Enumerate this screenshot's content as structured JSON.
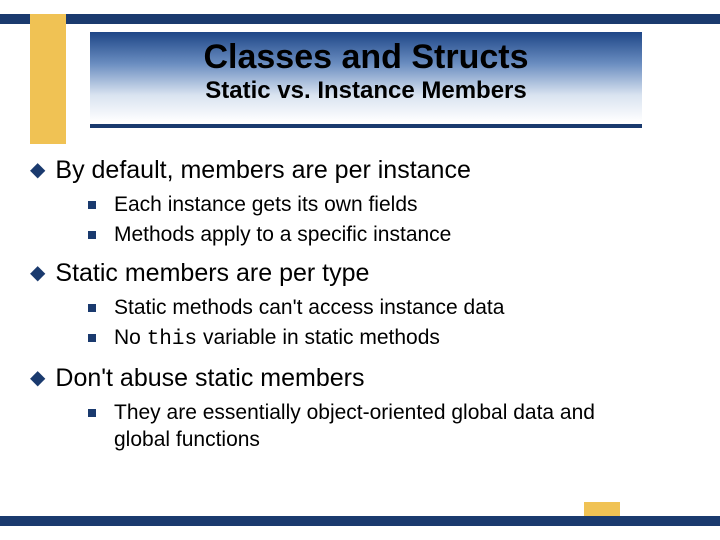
{
  "title": {
    "main": "Classes and Structs",
    "sub": "Static vs. Instance Members"
  },
  "bullets": [
    {
      "text": "By default, members are per instance",
      "sub": [
        "Each instance gets its own fields",
        "Methods apply to a specific instance"
      ]
    },
    {
      "text": "Static members are per type",
      "sub": [
        "Static methods can't access instance data",
        {
          "parts": [
            {
              "t": "No "
            },
            {
              "t": "this",
              "mono": true
            },
            {
              "t": " variable in static methods"
            }
          ]
        }
      ]
    },
    {
      "text": "Don't abuse static members",
      "sub": [
        "They are essentially object-oriented global data and global functions"
      ]
    }
  ]
}
